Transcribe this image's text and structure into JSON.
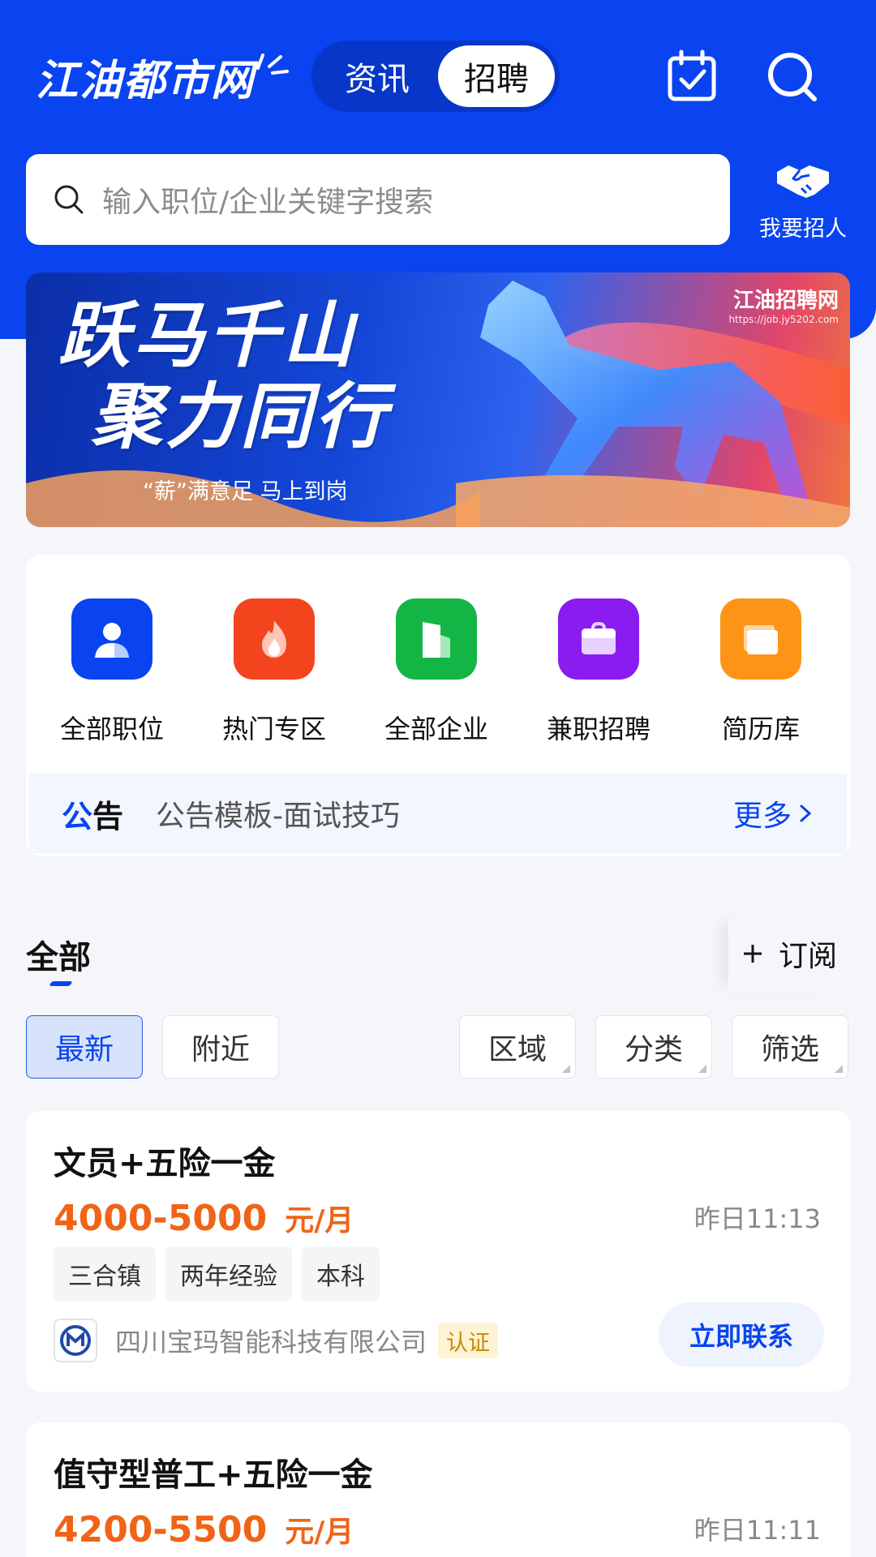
{
  "header": {
    "logo_text": "江油都市网",
    "tabs": [
      {
        "label": "资讯",
        "active": false
      },
      {
        "label": "招聘",
        "active": true
      }
    ],
    "icons": [
      "calendar-check-icon",
      "search-icon"
    ],
    "accent_color": "#0a44f0"
  },
  "search": {
    "placeholder": "输入职位/企业关键字搜索",
    "recruit_label": "我要招人"
  },
  "banner": {
    "title_line1": "跃马千山",
    "title_line2": "聚力同行",
    "subtitle": "“薪”满意足  马上到岗",
    "brand_name": "江油招聘网",
    "brand_url": "https://job.jy5202.com"
  },
  "quick_nav": [
    {
      "label": "全部职位",
      "icon": "person-icon",
      "color": "#0a44f0"
    },
    {
      "label": "热门专区",
      "icon": "flame-icon",
      "color": "#f4441e"
    },
    {
      "label": "全部企业",
      "icon": "building-icon",
      "color": "#13b545"
    },
    {
      "label": "兼职招聘",
      "icon": "briefcase-icon",
      "color": "#8a1cf0"
    },
    {
      "label": "简历库",
      "icon": "folder-icon",
      "color": "#fd9416"
    }
  ],
  "notice": {
    "title_part1": "公",
    "title_part2": "告",
    "text": "公告模板-面试技巧",
    "more": "更多"
  },
  "section": {
    "title": "全部",
    "subscribe": "订阅"
  },
  "filters": {
    "latest": "最新",
    "nearby": "附近",
    "area": "区域",
    "category": "分类",
    "filter": "筛选"
  },
  "jobs": [
    {
      "title": "文员+五险一金",
      "salary": "4000-5000",
      "unit": "元/月",
      "time": "昨日11:13",
      "tags": [
        "三合镇",
        "两年经验",
        "本科"
      ],
      "company": "四川宝玛智能科技有限公司",
      "verified": "认证",
      "contact": "立即联系"
    },
    {
      "title": "值守型普工+五险一金",
      "salary": "4200-5500",
      "unit": "元/月",
      "time": "昨日11:11"
    }
  ]
}
